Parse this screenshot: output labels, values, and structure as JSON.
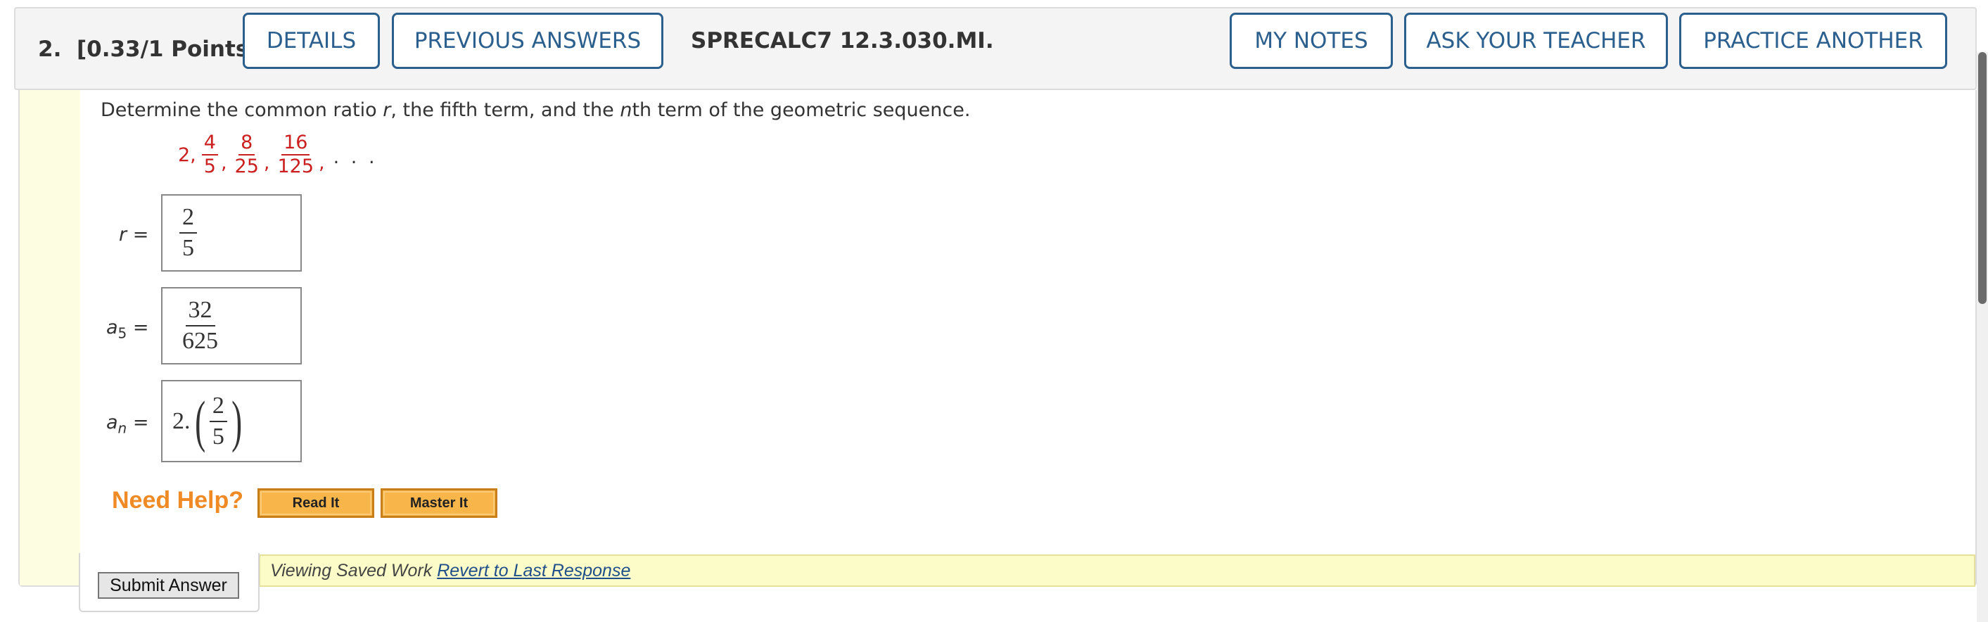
{
  "header": {
    "question_number": "2.",
    "points": "[0.33/1 Points]",
    "details_label": "DETAILS",
    "previous_answers_label": "PREVIOUS ANSWERS",
    "question_code": "SPRECALC7 12.3.030.MI.",
    "my_notes_label": "MY NOTES",
    "ask_teacher_label": "ASK YOUR TEACHER",
    "practice_another_label": "PRACTICE ANOTHER"
  },
  "question": {
    "prompt_part1": "Determine the common ratio ",
    "prompt_var_r": "r",
    "prompt_part2": ", the fifth term, and the ",
    "prompt_var_n": "n",
    "prompt_part3": "th term of the geometric sequence.",
    "sequence": {
      "first": "2,",
      "terms": [
        {
          "num": "4",
          "den": "5"
        },
        {
          "num": "8",
          "den": "25"
        },
        {
          "num": "16",
          "den": "125"
        }
      ],
      "ellipsis": ". . ."
    },
    "color_sequence": "#cc1f1f"
  },
  "answers": {
    "r": {
      "var": "r",
      "eq": "=",
      "num": "2",
      "den": "5"
    },
    "a5": {
      "var": "a",
      "sub": "5",
      "eq": "=",
      "num": "32",
      "den": "625"
    },
    "an": {
      "var": "a",
      "sub": "n",
      "eq": "=",
      "prefix": "2.",
      "num": "2",
      "den": "5",
      "lparen": "(",
      "rparen": ")"
    }
  },
  "help": {
    "need_help_label": "Need Help?",
    "read_it_label": "Read It",
    "master_it_label": "Master It",
    "color_need_help": "#f08a24"
  },
  "saved": {
    "message": "Viewing Saved Work",
    "revert_label": "Revert to Last Response"
  },
  "submit_label": "Submit Answer",
  "colors": {
    "accent": "#2b5f8e",
    "strip": "#fdfde2",
    "saved_bar": "#fcfcc9"
  }
}
